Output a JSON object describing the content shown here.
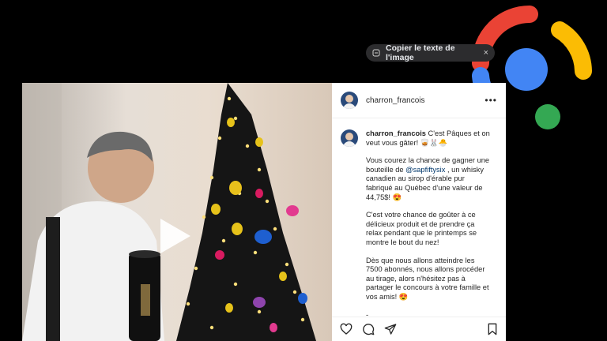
{
  "lens": {
    "copy_text_label": "Copier le texte de l'image",
    "close_glyph": "×",
    "colors": {
      "red": "#ea4335",
      "yellow": "#fbbc04",
      "blue": "#4285f4",
      "green": "#34a853"
    }
  },
  "post": {
    "header_username": "charron_francois",
    "more_glyph": "•••",
    "caption_username": "charron_francois",
    "caption_lead": " C'est Pâques et on veut vous gâter! 🥃🐰🐣",
    "para2_before": "Vous courez la chance de gagner une bouteille de ",
    "para2_mention": "@sapfiftysix",
    "para2_after": " , un whisky canadien au sirop d'érable pur fabriqué au Québec d'une valeur de 44,75$! 😍",
    "para3": "C'est votre chance de goûter à ce délicieux produit et de prendre ça relax pendant que le printemps se montre le bout du nez!",
    "para4": "Dès que nous allons atteindre les 7500 abonnés, nous allons procéder au tirage, alors n'hésitez pas à partager le concours à votre famille et vos amis! 😍",
    "para5": "-"
  }
}
